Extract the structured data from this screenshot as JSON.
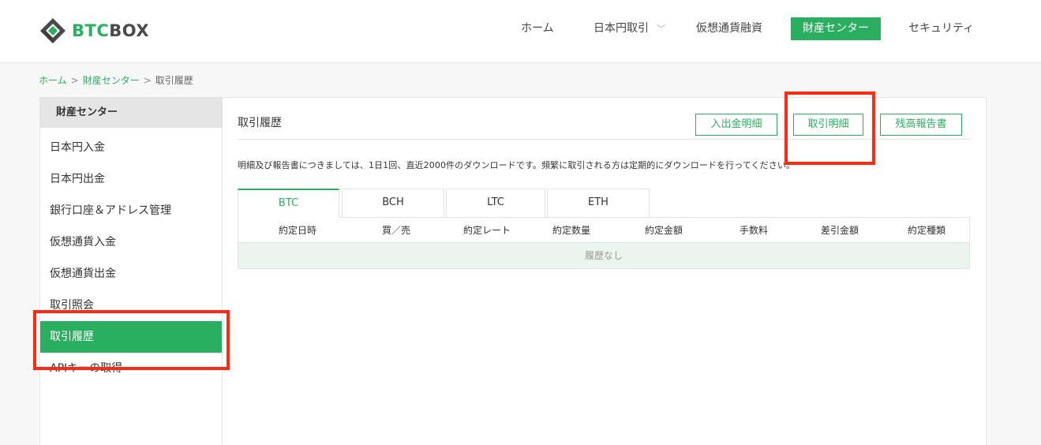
{
  "header": {
    "logo": {
      "btc": "BTC",
      "box": "BOX"
    },
    "nav": {
      "home": "ホーム",
      "jpy_trade": "日本円取引",
      "crypto_loan": "仮想通貨融資",
      "asset_center": "財産センター",
      "security": "セキュリティ"
    }
  },
  "breadcrumb": {
    "home": "ホーム",
    "separator": ">",
    "asset_center": "財産センター",
    "current": "取引履歴"
  },
  "sidebar": {
    "heading": "財産センター",
    "items": [
      {
        "label": "日本円入金"
      },
      {
        "label": "日本円出金"
      },
      {
        "label": "銀行口座＆アドレス管理"
      },
      {
        "label": "仮想通貨入金"
      },
      {
        "label": "仮想通貨出金"
      },
      {
        "label": "取引照会"
      },
      {
        "label": "取引履歴"
      },
      {
        "label": "APIキーの取得"
      }
    ]
  },
  "main": {
    "title": "取引履歴",
    "buttons": {
      "deposit_statement": "入出金明細",
      "trade_statement": "取引明細",
      "balance_report": "残高報告書"
    },
    "notice": "明細及び報告書につきましては、1日1回、直近2000件のダウンロードです。頻繁に取引される方は定期的にダウンロードを行ってください。",
    "tabs": [
      "BTC",
      "BCH",
      "LTC",
      "ETH"
    ],
    "table": {
      "columns": [
        "約定日時",
        "買／売",
        "約定レート",
        "約定数量",
        "約定金額",
        "手数料",
        "差引金額",
        "約定種類"
      ],
      "empty_text": "履歴なし"
    }
  },
  "colors": {
    "accent": "#2aae5f",
    "annotation": "#ff2a12"
  },
  "icons": {
    "logo": "diamond-logo-icon",
    "dropdown": "chevron-down-icon"
  }
}
